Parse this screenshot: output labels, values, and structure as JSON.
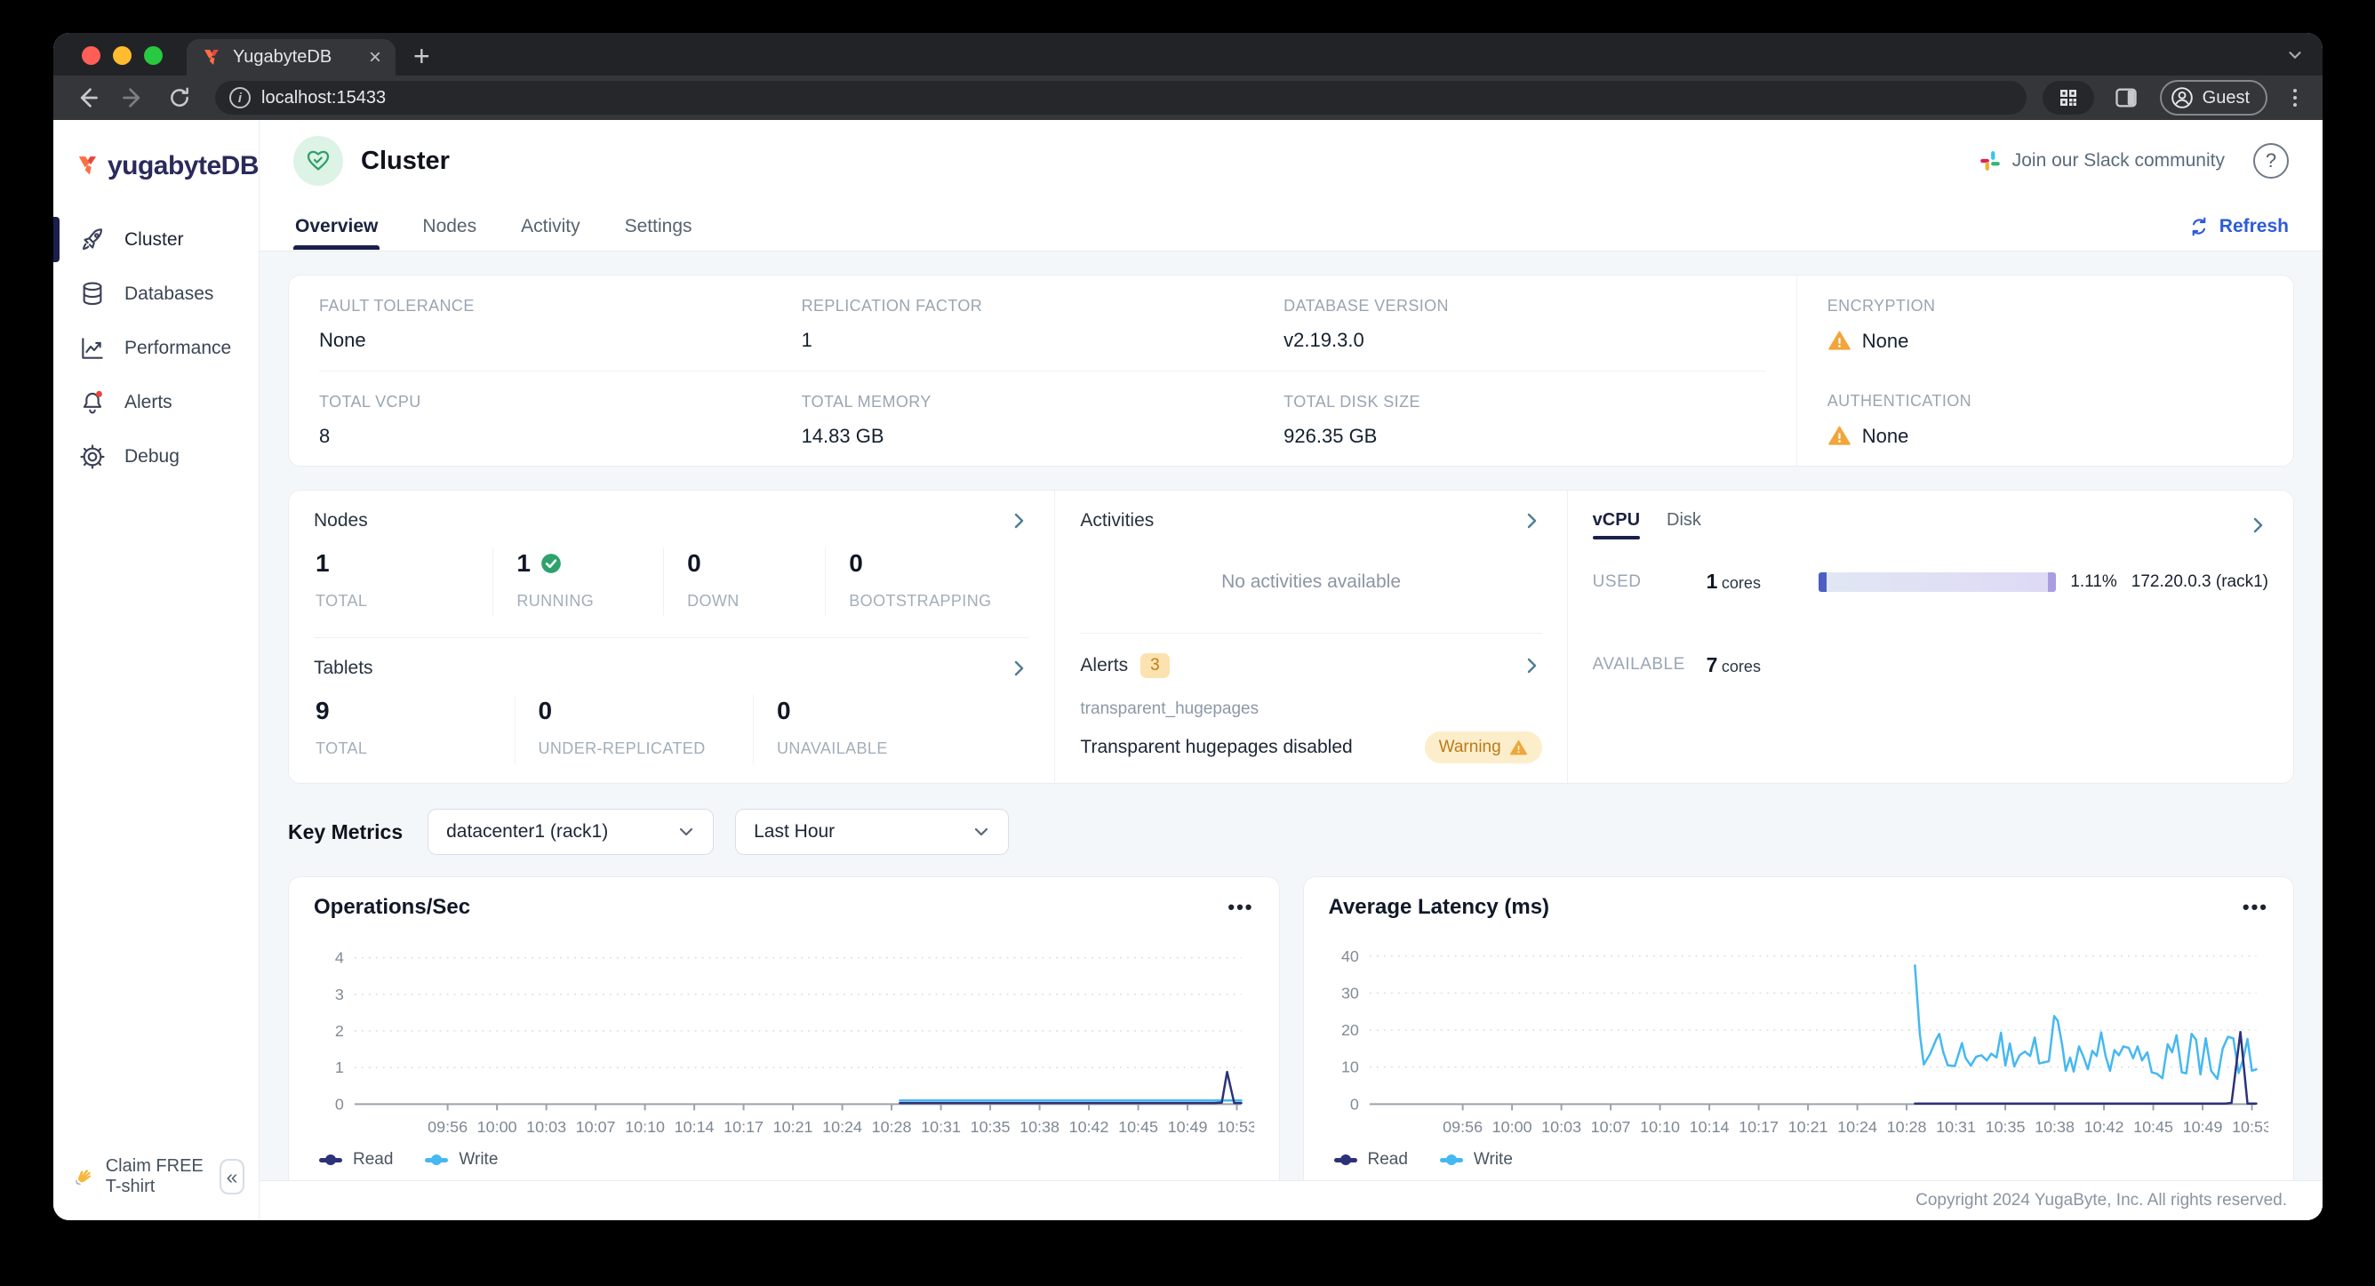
{
  "browser": {
    "tab_title": "YugabyteDB",
    "tab_close_glyph": "×",
    "new_tab_glyph": "+",
    "url": "localhost:15433",
    "profile_label": "Guest"
  },
  "sidebar": {
    "logo_text": "yugabyteDB",
    "items": [
      {
        "label": "Cluster",
        "icon": "rocket-icon",
        "active": true
      },
      {
        "label": "Databases",
        "icon": "database-icon",
        "active": false
      },
      {
        "label": "Performance",
        "icon": "performance-icon",
        "active": false
      },
      {
        "label": "Alerts",
        "icon": "bell-icon",
        "active": false,
        "has_dot": true
      },
      {
        "label": "Debug",
        "icon": "gear-icon",
        "active": false
      }
    ],
    "footer_label": "Claim FREE T-shirt",
    "collapse_glyph": "«"
  },
  "header": {
    "title": "Cluster",
    "slack_label": "Join our Slack community",
    "help_glyph": "?"
  },
  "tabbar": {
    "tabs": [
      {
        "label": "Overview",
        "active": true
      },
      {
        "label": "Nodes",
        "active": false
      },
      {
        "label": "Activity",
        "active": false
      },
      {
        "label": "Settings",
        "active": false
      }
    ],
    "refresh_label": "Refresh"
  },
  "overview": {
    "fields": [
      {
        "label": "FAULT TOLERANCE",
        "value": "None"
      },
      {
        "label": "REPLICATION FACTOR",
        "value": "1"
      },
      {
        "label": "DATABASE VERSION",
        "value": "v2.19.3.0"
      },
      {
        "label": "TOTAL VCPU",
        "value": "8"
      },
      {
        "label": "TOTAL MEMORY",
        "value": "14.83 GB"
      },
      {
        "label": "TOTAL DISK SIZE",
        "value": "926.35 GB"
      }
    ],
    "security": [
      {
        "label": "ENCRYPTION",
        "value": "None"
      },
      {
        "label": "AUTHENTICATION",
        "value": "None"
      }
    ]
  },
  "cluster_panel": {
    "nodes": {
      "title": "Nodes",
      "stats": [
        {
          "value": "1",
          "label": "TOTAL"
        },
        {
          "value": "1",
          "label": "RUNNING",
          "check": true
        },
        {
          "value": "0",
          "label": "DOWN"
        },
        {
          "value": "0",
          "label": "BOOTSTRAPPING"
        }
      ]
    },
    "tablets": {
      "title": "Tablets",
      "stats": [
        {
          "value": "9",
          "label": "TOTAL"
        },
        {
          "value": "0",
          "label": "UNDER-REPLICATED"
        },
        {
          "value": "0",
          "label": "UNAVAILABLE"
        }
      ]
    },
    "activities": {
      "title": "Activities",
      "empty_text": "No activities available"
    },
    "alerts": {
      "title": "Alerts",
      "count": "3",
      "item_name": "transparent_hugepages",
      "item_message": "Transparent hugepages disabled",
      "severity": "Warning"
    },
    "usage": {
      "tabs": [
        {
          "label": "vCPU",
          "active": true
        },
        {
          "label": "Disk",
          "active": false
        }
      ],
      "used_label": "USED",
      "used_value": "1",
      "used_unit": "cores",
      "used_percent": "1.11%",
      "used_node": "172.20.0.3 (rack1)",
      "available_label": "AVAILABLE",
      "available_value": "7",
      "available_unit": "cores"
    }
  },
  "key_metrics": {
    "title": "Key Metrics",
    "cluster_filter": "datacenter1 (rack1)",
    "time_filter": "Last Hour",
    "menu_glyph": "•••"
  },
  "chart_data": [
    {
      "type": "line",
      "title": "Operations/Sec",
      "ylabel": "",
      "ylim": [
        0,
        4.6
      ],
      "yticks": [
        0,
        1,
        2,
        3,
        4
      ],
      "xticks": [
        "09:56",
        "10:00",
        "10:03",
        "10:07",
        "10:10",
        "10:14",
        "10:17",
        "10:21",
        "10:24",
        "10:28",
        "10:31",
        "10:35",
        "10:38",
        "10:42",
        "10:45",
        "10:49",
        "10:53"
      ],
      "xtick_start": 0.105,
      "xtick_end": 0.995,
      "grid": "dotted-horizontal",
      "legend_position": "bottom-left",
      "series": [
        {
          "name": "Read",
          "color": "#2c3178",
          "points": [
            [
              0.615,
              0.03
            ],
            [
              0.97,
              0.03
            ],
            [
              0.978,
              0.04
            ],
            [
              0.984,
              0.88
            ],
            [
              0.992,
              0.03
            ],
            [
              1,
              0.03
            ]
          ]
        },
        {
          "name": "Write",
          "color": "#45b8f2",
          "points": [
            [
              0.615,
              0.1
            ],
            [
              1,
              0.1
            ]
          ]
        }
      ]
    },
    {
      "type": "line",
      "title": "Average Latency (ms)",
      "ylabel": "",
      "ylim": [
        0,
        45.5
      ],
      "yticks": [
        0,
        10,
        20,
        30,
        40
      ],
      "xticks": [
        "09:56",
        "10:00",
        "10:03",
        "10:07",
        "10:10",
        "10:14",
        "10:17",
        "10:21",
        "10:24",
        "10:28",
        "10:31",
        "10:35",
        "10:38",
        "10:42",
        "10:45",
        "10:49",
        "10:53"
      ],
      "xtick_start": 0.105,
      "xtick_end": 0.995,
      "grid": "dotted-horizontal",
      "legend_position": "bottom-left",
      "series": [
        {
          "name": "Read",
          "color": "#2c3178",
          "points": [
            [
              0.615,
              0.15
            ],
            [
              0.965,
              0.15
            ],
            [
              0.972,
              0.3
            ],
            [
              0.982,
              19.5
            ],
            [
              0.99,
              0.15
            ],
            [
              1,
              0.15
            ]
          ]
        },
        {
          "name": "Write",
          "color": "#45b8f2",
          "points": [
            [
              0.615,
              37.5
            ],
            [
              0.6205,
              19
            ],
            [
              0.625,
              10.7
            ],
            [
              0.632,
              13.5
            ],
            [
              0.639,
              17.5
            ],
            [
              0.6425,
              19
            ],
            [
              0.647,
              14
            ],
            [
              0.652,
              10.5
            ],
            [
              0.66,
              10.3
            ],
            [
              0.668,
              16.5
            ],
            [
              0.672,
              12.5
            ],
            [
              0.678,
              10.4
            ],
            [
              0.684,
              12.8
            ],
            [
              0.69,
              13.2
            ],
            [
              0.696,
              11.8
            ],
            [
              0.701,
              13.6
            ],
            [
              0.707,
              12.6
            ],
            [
              0.712,
              19.3
            ],
            [
              0.717,
              10.4
            ],
            [
              0.722,
              16.4
            ],
            [
              0.727,
              10.2
            ],
            [
              0.733,
              13.2
            ],
            [
              0.739,
              14.2
            ],
            [
              0.745,
              13
            ],
            [
              0.75,
              18
            ],
            [
              0.755,
              11
            ],
            [
              0.761,
              11.3
            ],
            [
              0.766,
              11.6
            ],
            [
              0.772,
              23.8
            ],
            [
              0.776,
              22.5
            ],
            [
              0.781,
              16
            ],
            [
              0.785,
              9
            ],
            [
              0.79,
              12.6
            ],
            [
              0.794,
              8.8
            ],
            [
              0.8,
              15.6
            ],
            [
              0.805,
              12.8
            ],
            [
              0.81,
              9.4
            ],
            [
              0.815,
              14.4
            ],
            [
              0.82,
              13
            ],
            [
              0.825,
              19.4
            ],
            [
              0.83,
              13
            ],
            [
              0.835,
              9
            ],
            [
              0.84,
              14.6
            ],
            [
              0.845,
              13.2
            ],
            [
              0.85,
              15.6
            ],
            [
              0.856,
              15.2
            ],
            [
              0.861,
              12.4
            ],
            [
              0.866,
              15.6
            ],
            [
              0.871,
              11.8
            ],
            [
              0.877,
              14
            ],
            [
              0.882,
              8.6
            ],
            [
              0.888,
              8.2
            ],
            [
              0.894,
              7
            ],
            [
              0.9,
              16.2
            ],
            [
              0.905,
              14
            ],
            [
              0.91,
              18.6
            ],
            [
              0.916,
              8.6
            ],
            [
              0.921,
              8.3
            ],
            [
              0.927,
              19
            ],
            [
              0.932,
              17.4
            ],
            [
              0.937,
              8
            ],
            [
              0.943,
              17.8
            ],
            [
              0.949,
              9
            ],
            [
              0.956,
              6.8
            ],
            [
              0.962,
              15
            ],
            [
              0.968,
              18.2
            ],
            [
              0.974,
              17.8
            ],
            [
              0.98,
              8.4
            ],
            [
              0.985,
              12
            ],
            [
              0.99,
              17.6
            ],
            [
              0.995,
              9
            ],
            [
              1,
              9.4
            ]
          ]
        }
      ]
    }
  ],
  "footer": {
    "copyright": "Copyright 2024 YugaByte, Inc. All rights reserved."
  },
  "colors": {
    "accent_blue": "#2d5bd7",
    "navy": "#1a1f4c",
    "warning_orange": "#f2a53a",
    "series_read": "#2c3178",
    "series_write": "#45b8f2",
    "success_green": "#2ea26b"
  }
}
